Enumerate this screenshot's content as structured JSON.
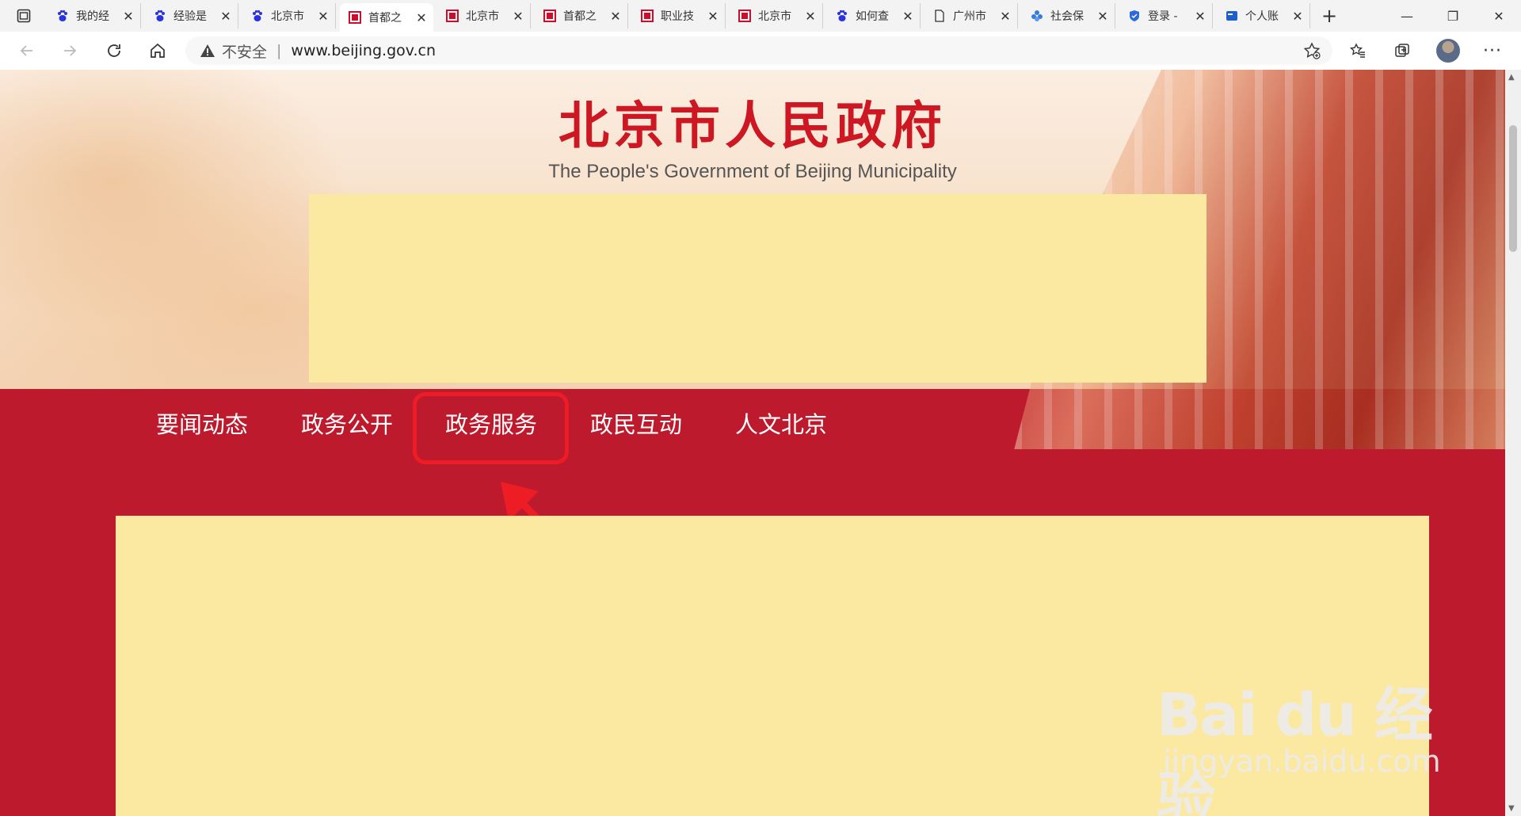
{
  "tabs": [
    {
      "title": "我的经",
      "icon": "baidu-paw-icon",
      "active": false
    },
    {
      "title": "经验是",
      "icon": "baidu-paw-icon",
      "active": false
    },
    {
      "title": "北京市",
      "icon": "baidu-paw-icon",
      "active": false
    },
    {
      "title": "首都之",
      "icon": "beijing-gov-icon",
      "active": true
    },
    {
      "title": "北京市",
      "icon": "beijing-gov-icon",
      "active": false
    },
    {
      "title": "首都之",
      "icon": "beijing-gov-icon",
      "active": false
    },
    {
      "title": "职业技",
      "icon": "beijing-gov-icon",
      "active": false
    },
    {
      "title": "北京市",
      "icon": "beijing-gov-icon",
      "active": false
    },
    {
      "title": "如何查",
      "icon": "baidu-paw-icon",
      "active": false
    },
    {
      "title": "广州市",
      "icon": "document-icon",
      "active": false
    },
    {
      "title": "社会保",
      "icon": "flower-icon",
      "active": false
    },
    {
      "title": "登录 -",
      "icon": "shield-icon",
      "active": false
    },
    {
      "title": "个人账",
      "icon": "card-icon",
      "active": false
    }
  ],
  "address_bar": {
    "security_label": "不安全",
    "url": "www.beijing.gov.cn"
  },
  "site": {
    "title": "北京市人民政府",
    "subtitle": "The People's Government of Beijing Municipality"
  },
  "nav": {
    "items": [
      "要闻动态",
      "政务公开",
      "政务服务",
      "政民互动",
      "人文北京"
    ],
    "highlighted": "政务服务"
  },
  "watermark": {
    "main": "Bai du 经验",
    "sub": "jingyan.baidu.com"
  },
  "colors": {
    "brand_red": "#be1a2d",
    "title_red": "#cd1823",
    "placeholder_yellow": "#fbe9a2",
    "annotation_red": "#ee1c24"
  }
}
